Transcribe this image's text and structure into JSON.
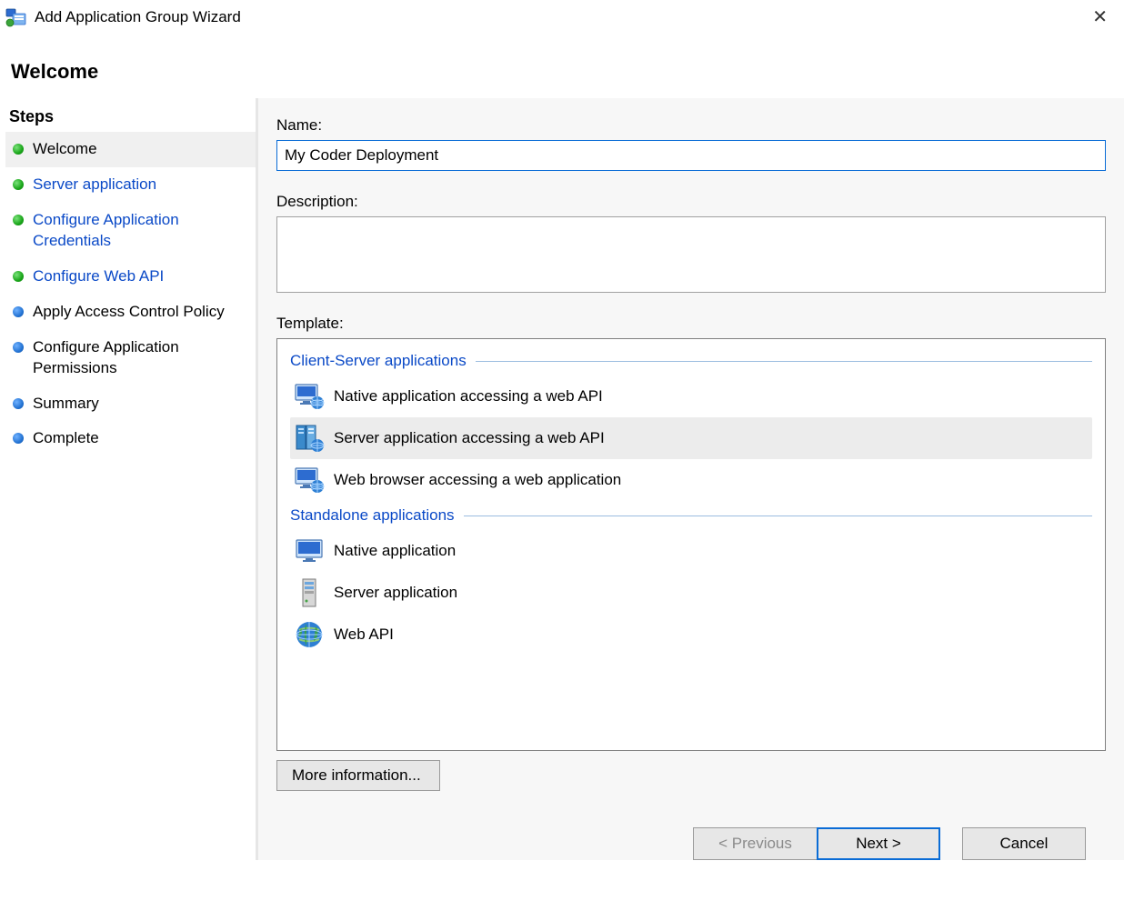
{
  "window": {
    "title": "Add Application Group Wizard",
    "close_label": "✕"
  },
  "header": {
    "title": "Welcome"
  },
  "steps": {
    "title": "Steps",
    "items": [
      {
        "label": "Welcome",
        "bullet": "green",
        "state": "active"
      },
      {
        "label": "Server application",
        "bullet": "green",
        "state": "visited"
      },
      {
        "label": "Configure Application Credentials",
        "bullet": "green",
        "state": "visited"
      },
      {
        "label": "Configure Web API",
        "bullet": "green",
        "state": "visited"
      },
      {
        "label": "Apply Access Control Policy",
        "bullet": "blue",
        "state": "pending"
      },
      {
        "label": "Configure Application Permissions",
        "bullet": "blue",
        "state": "pending"
      },
      {
        "label": "Summary",
        "bullet": "blue",
        "state": "pending"
      },
      {
        "label": "Complete",
        "bullet": "blue",
        "state": "pending"
      }
    ]
  },
  "form": {
    "name_label": "Name:",
    "name_value": "My Coder Deployment",
    "description_label": "Description:",
    "description_value": "",
    "template_label": "Template:",
    "more_info_label": "More information..."
  },
  "templates": {
    "groups": [
      {
        "title": "Client-Server applications",
        "options": [
          {
            "label": "Native application accessing a web API",
            "icon": "monitor-globe",
            "selected": false
          },
          {
            "label": "Server application accessing a web API",
            "icon": "server-globe",
            "selected": true
          },
          {
            "label": "Web browser accessing a web application",
            "icon": "monitor-globe",
            "selected": false
          }
        ]
      },
      {
        "title": "Standalone applications",
        "options": [
          {
            "label": "Native application",
            "icon": "monitor",
            "selected": false
          },
          {
            "label": "Server application",
            "icon": "server",
            "selected": false
          },
          {
            "label": "Web API",
            "icon": "globe",
            "selected": false
          }
        ]
      }
    ]
  },
  "footer": {
    "previous_label": "< Previous",
    "next_label": "Next >",
    "cancel_label": "Cancel"
  }
}
